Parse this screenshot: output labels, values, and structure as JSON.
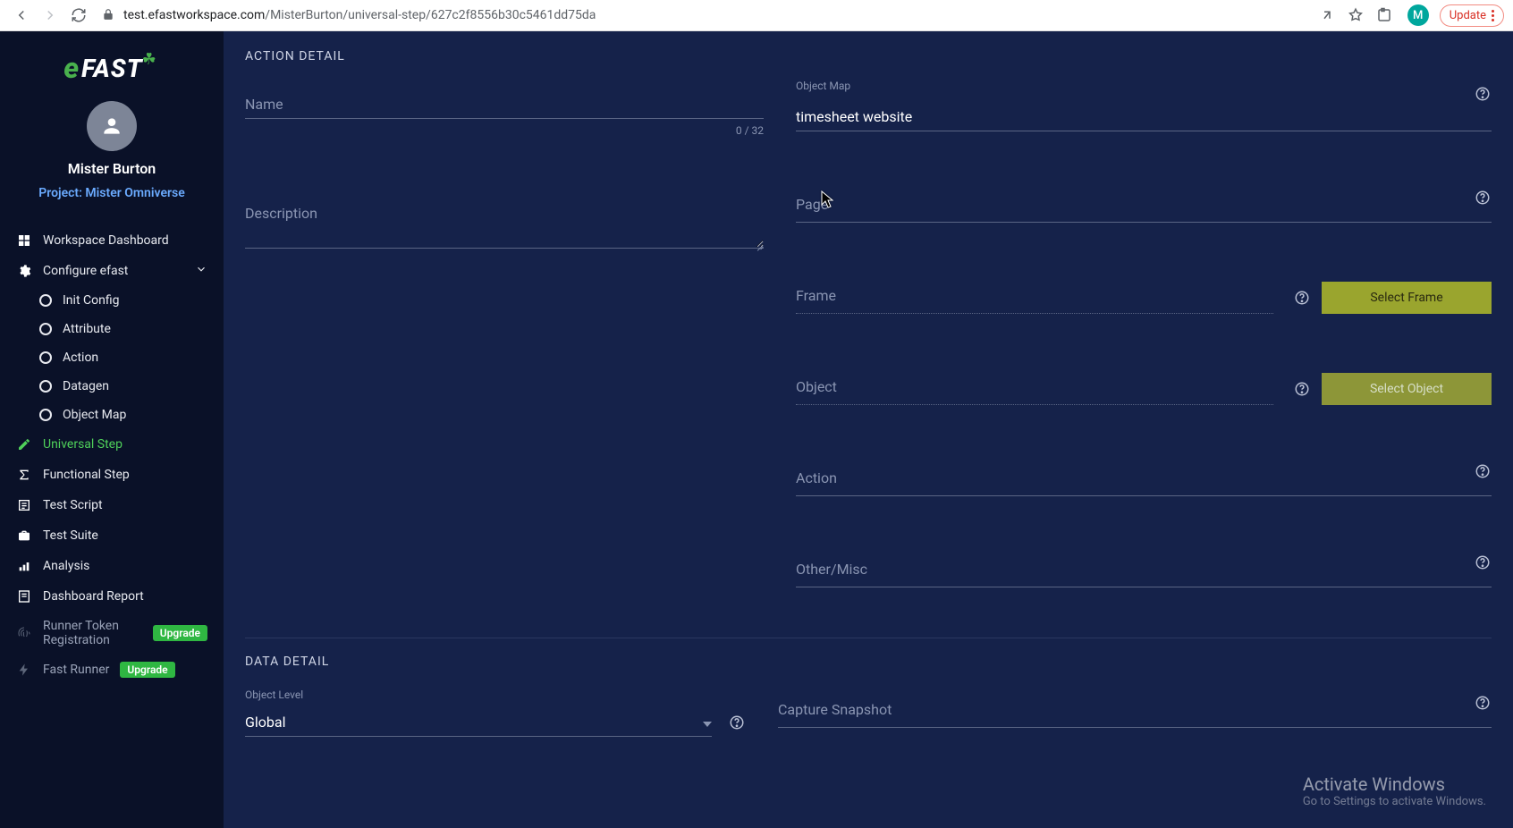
{
  "browser": {
    "url_host": "test.efastworkspace.com",
    "url_path": "/MisterBurton/universal-step/627c2f8556b30c5461dd75da",
    "update_label": "Update",
    "avatar_initial": "M"
  },
  "brand": {
    "logo_e": "e",
    "logo_text": "FAST"
  },
  "profile": {
    "username": "Mister Burton",
    "project_label": "Project: Mister Omniverse"
  },
  "sidebar": {
    "items": [
      {
        "label": "Workspace Dashboard",
        "kind": "item"
      },
      {
        "label": "Configure efast",
        "kind": "expandable"
      },
      {
        "label": "Init Config",
        "kind": "sub"
      },
      {
        "label": "Attribute",
        "kind": "sub"
      },
      {
        "label": "Action",
        "kind": "sub"
      },
      {
        "label": "Datagen",
        "kind": "sub"
      },
      {
        "label": "Object Map",
        "kind": "sub"
      },
      {
        "label": "Universal Step",
        "kind": "active"
      },
      {
        "label": "Functional Step",
        "kind": "item"
      },
      {
        "label": "Test Script",
        "kind": "item"
      },
      {
        "label": "Test Suite",
        "kind": "item"
      },
      {
        "label": "Analysis",
        "kind": "item"
      },
      {
        "label": "Dashboard Report",
        "kind": "item"
      },
      {
        "label": "Runner Token Registration",
        "kind": "upgrade",
        "badge": "Upgrade"
      },
      {
        "label": "Fast Runner",
        "kind": "upgrade",
        "badge": "Upgrade"
      }
    ]
  },
  "sections": {
    "action_detail": "ACTION DETAIL",
    "data_detail": "DATA DETAIL"
  },
  "form": {
    "name_label": "Name",
    "name_counter": "0 / 32",
    "description_label": "Description",
    "object_map_label": "Object Map",
    "object_map_value": "timesheet website",
    "page_label": "Page",
    "frame_label": "Frame",
    "select_frame_btn": "Select Frame",
    "object_label": "Object",
    "select_object_btn": "Select Object",
    "action_label": "Action",
    "other_label": "Other/Misc",
    "object_level_label": "Object Level",
    "object_level_value": "Global",
    "capture_snapshot_label": "Capture Snapshot"
  },
  "watermark": {
    "title": "Activate Windows",
    "subtitle": "Go to Settings to activate Windows."
  }
}
